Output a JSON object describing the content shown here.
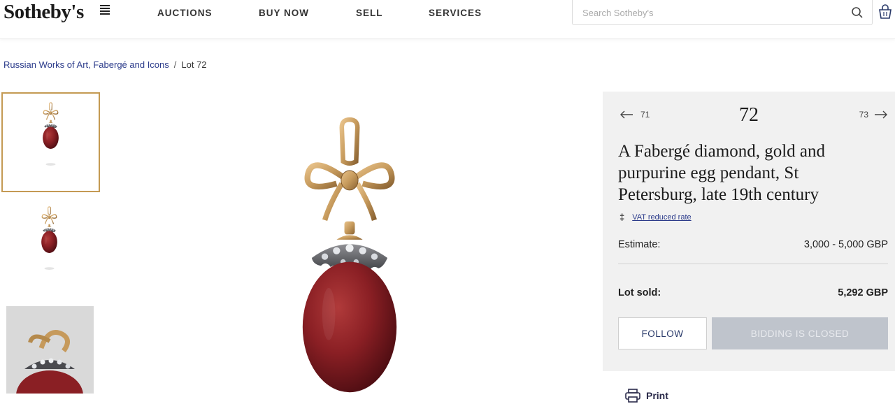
{
  "header": {
    "logo": "Sotheby's",
    "nav": [
      "AUCTIONS",
      "BUY NOW",
      "SELL",
      "SERVICES"
    ],
    "search_placeholder": "Search Sotheby's",
    "icons": [
      "search-icon",
      "bag-icon"
    ]
  },
  "breadcrumb": {
    "parent": "Russian Works of Art, Fabergé and Icons",
    "separator": "/",
    "current": "Lot 72"
  },
  "lot": {
    "prev": "71",
    "number": "72",
    "next": "73",
    "title": "A Fabergé diamond, gold and purpurine egg pendant, St Petersburg, late 19th century",
    "vat_label": "VAT reduced rate",
    "estimate_label": "Estimate:",
    "estimate_value": "3,000 - 5,000 GBP",
    "sold_label": "Lot sold:",
    "sold_value": "5,292 GBP",
    "follow_label": "FOLLOW",
    "bidding_label": "BIDDING IS CLOSED",
    "print_label": "Print"
  },
  "colors": {
    "accent_gold": "#c49a53",
    "link_blue": "#2a3a8a",
    "panel_bg": "#f1f1f1",
    "purpurine": "#8b1e24"
  }
}
